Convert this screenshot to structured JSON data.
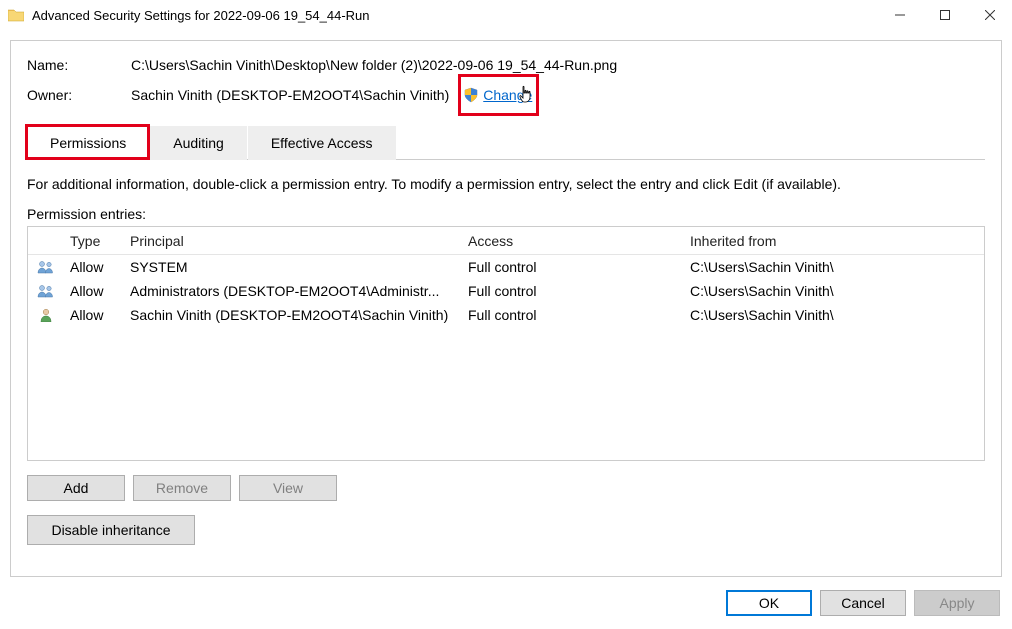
{
  "window": {
    "title": "Advanced Security Settings for 2022-09-06 19_54_44-Run"
  },
  "meta": {
    "name_label": "Name:",
    "name_value": "C:\\Users\\Sachin Vinith\\Desktop\\New folder (2)\\2022-09-06 19_54_44-Run.png",
    "owner_label": "Owner:",
    "owner_value": "Sachin Vinith (DESKTOP-EM2OOT4\\Sachin Vinith)",
    "change_label": "Change"
  },
  "tabs": {
    "permissions": "Permissions",
    "auditing": "Auditing",
    "effective": "Effective Access"
  },
  "text": {
    "info": "For additional information, double-click a permission entry. To modify a permission entry, select the entry and click Edit (if available).",
    "permission_entries": "Permission entries:"
  },
  "table": {
    "headers": {
      "type": "Type",
      "principal": "Principal",
      "access": "Access",
      "inherited": "Inherited from"
    },
    "rows": [
      {
        "icon": "group",
        "type": "Allow",
        "principal": "SYSTEM",
        "access": "Full control",
        "inherited": "C:\\Users\\Sachin Vinith\\"
      },
      {
        "icon": "group",
        "type": "Allow",
        "principal": "Administrators (DESKTOP-EM2OOT4\\Administr...",
        "access": "Full control",
        "inherited": "C:\\Users\\Sachin Vinith\\"
      },
      {
        "icon": "user",
        "type": "Allow",
        "principal": "Sachin Vinith (DESKTOP-EM2OOT4\\Sachin Vinith)",
        "access": "Full control",
        "inherited": "C:\\Users\\Sachin Vinith\\"
      }
    ]
  },
  "buttons": {
    "add": "Add",
    "remove": "Remove",
    "view": "View",
    "disable_inh": "Disable inheritance",
    "ok": "OK",
    "cancel": "Cancel",
    "apply": "Apply"
  }
}
